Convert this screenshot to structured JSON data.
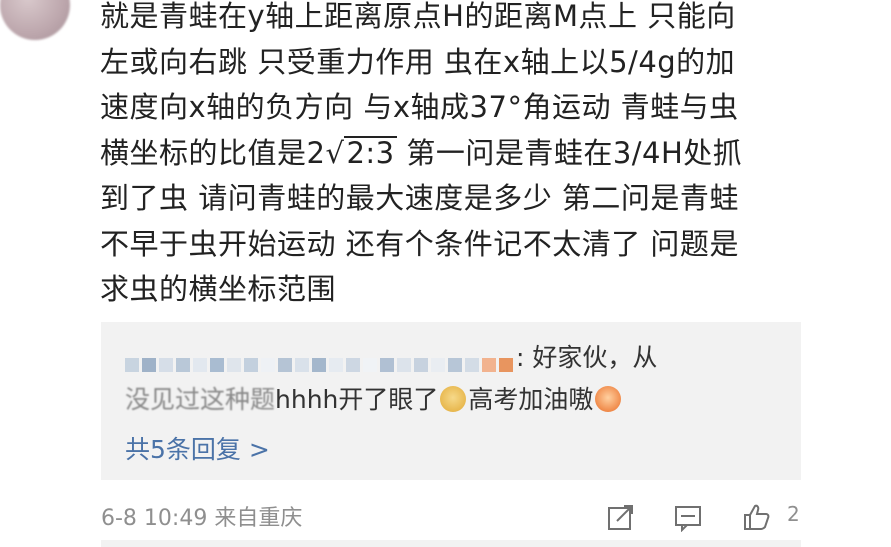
{
  "post": {
    "lines": [
      "就是青蛙在y轴上距离原点H的距离M点上 只能向",
      "左或向右跳 只受重力作用 虫在x轴上以5/4g的加",
      "速度向x轴的负方向 与x轴成37°角运动 青蛙与虫",
      "横坐标的比值是2",
      "到了虫 请问青蛙的最大速度是多少 第二问是青蛙",
      "不早于虫开始运动 还有个条件记不太清了 问题是",
      "求虫的横坐标范围"
    ],
    "ratio_radicand": "2:3",
    "ratio_sqrt": "√",
    "line4_rest": "  第一问是青蛙在3/4H处抓"
  },
  "reply": {
    "line1_text": ": 好家伙，从",
    "line2_blurred": "没见过这种题",
    "line2_text": "hhhh开了眼了",
    "line2_end": "高考加油嗷",
    "more_replies": "共5条回复 >"
  },
  "footer": {
    "timestamp": "6-8 10:49  来自重庆",
    "like_count": "2"
  },
  "icons": [
    "avatar",
    "share-icon",
    "comment-icon",
    "like-icon",
    "doge-emoji-icon",
    "fighting-emoji-icon"
  ],
  "colors": {
    "text": "#222222",
    "reply_bg": "#f2f2f2",
    "link": "#4b73a8",
    "meta": "#8f8f8f"
  }
}
